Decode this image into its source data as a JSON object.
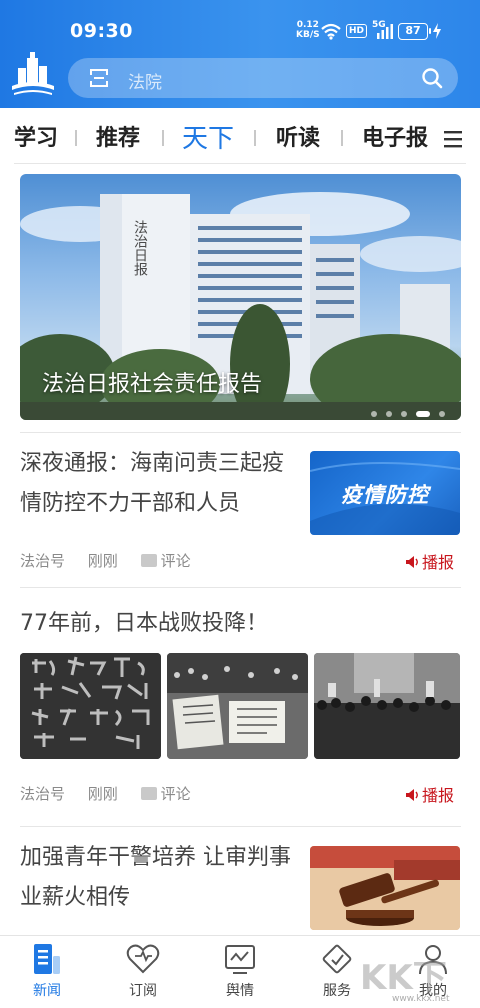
{
  "status": {
    "time": "09:30",
    "net_speed_value": "0.12",
    "net_speed_unit": "KB/S",
    "hd": "HD",
    "network": "5G",
    "battery": "87"
  },
  "search": {
    "placeholder": "法院"
  },
  "tabs": [
    {
      "label": "学习",
      "active": false
    },
    {
      "label": "推荐",
      "active": false
    },
    {
      "label": "天下",
      "active": true
    },
    {
      "label": "听读",
      "active": false
    },
    {
      "label": "电子报",
      "active": false
    }
  ],
  "banner": {
    "caption": "法治日报社会责任报告",
    "page_count": 5,
    "current_page": 4,
    "building_sign": "法治日报"
  },
  "articles": [
    {
      "title_line1": "深夜通报：海南问责三起疫",
      "title_line2": "情防控不力干部和人员",
      "thumb_text": "疫情防控",
      "source": "法治号",
      "time": "刚刚",
      "comment": "评论",
      "broadcast": "播报"
    },
    {
      "title": "77年前，日本战败投降！",
      "source": "法治号",
      "time": "刚刚",
      "comment": "评论",
      "broadcast": "播报"
    },
    {
      "title_line1": "加强青年干警培养 让审判事",
      "title_line2": "业薪火相传"
    }
  ],
  "nav": [
    {
      "label": "新闻",
      "active": true
    },
    {
      "label": "订阅",
      "active": false
    },
    {
      "label": "舆情",
      "active": false
    },
    {
      "label": "服务",
      "active": false
    },
    {
      "label": "我的",
      "active": false
    }
  ],
  "watermark": {
    "text": "KK下载",
    "url": "www.kkx.net"
  },
  "colors": {
    "brand_blue": "#1f78e3",
    "broadcast_red": "#c8161d"
  }
}
